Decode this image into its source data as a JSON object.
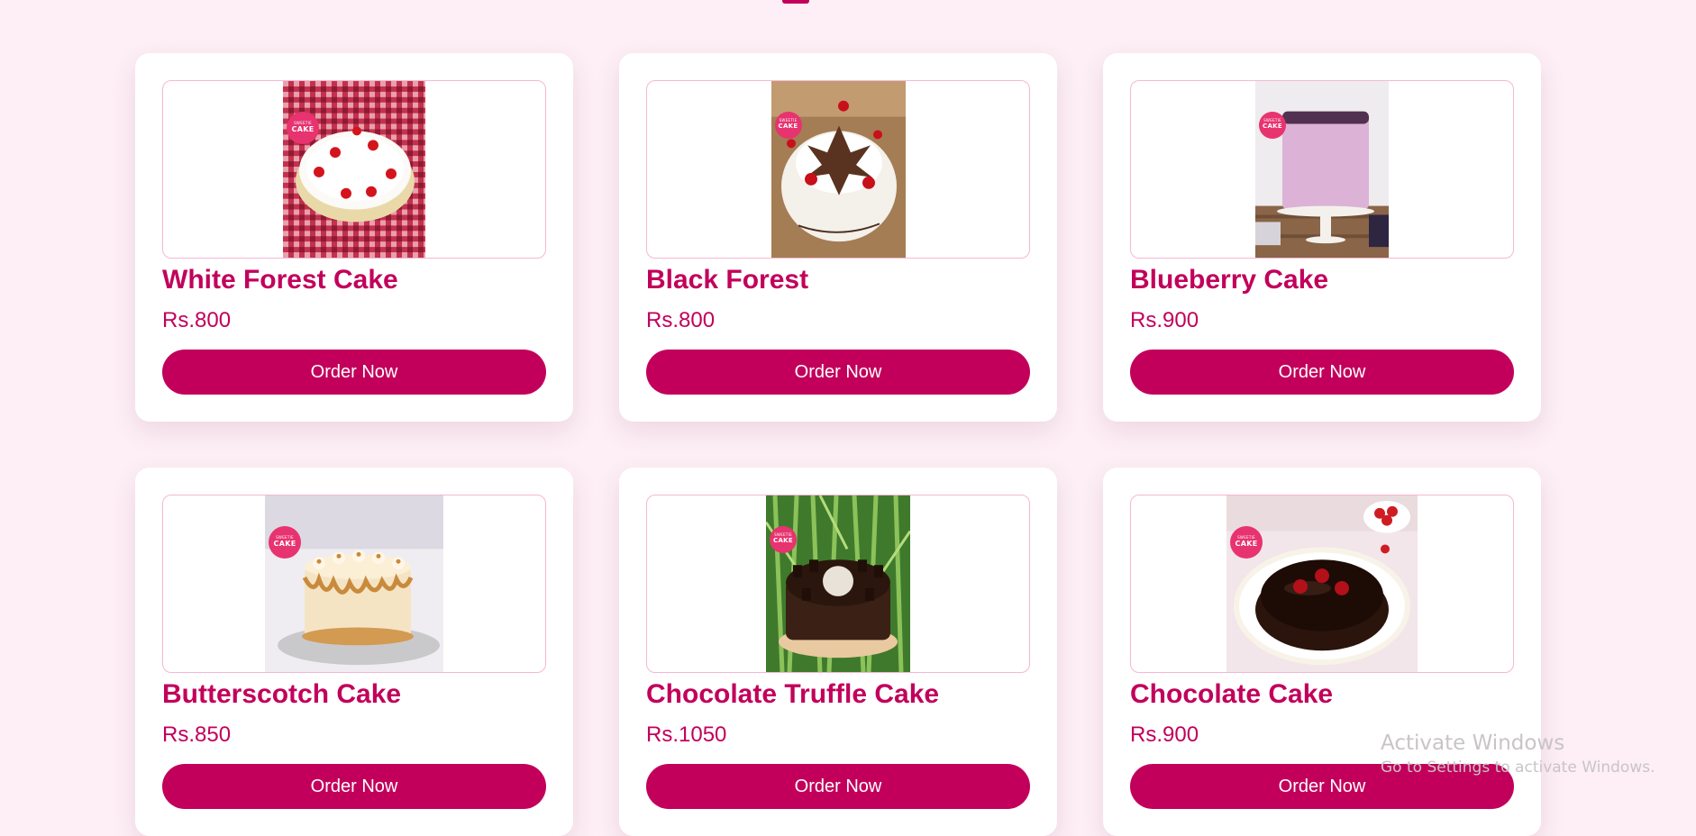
{
  "theme": {
    "background": "#fdeff5",
    "accent": "#c2005b",
    "card": "#ffffff",
    "frame_border": "#f6b7d2",
    "badge": "#e7336f"
  },
  "products": [
    {
      "name": "White Forest Cake",
      "price": "Rs.800",
      "button": "Order Now",
      "image": "white-forest-cake-photo"
    },
    {
      "name": "Black Forest",
      "price": "Rs.800",
      "button": "Order Now",
      "image": "black-forest-cake-photo"
    },
    {
      "name": "Blueberry Cake",
      "price": "Rs.900",
      "button": "Order Now",
      "image": "blueberry-cake-photo"
    },
    {
      "name": "Butterscotch Cake",
      "price": "Rs.850",
      "button": "Order Now",
      "image": "butterscotch-cake-photo"
    },
    {
      "name": "Chocolate Truffle Cake",
      "price": "Rs.1050",
      "button": "Order Now",
      "image": "chocolate-truffle-cake-photo"
    },
    {
      "name": "Chocolate Cake",
      "price": "Rs.900",
      "button": "Order Now",
      "image": "chocolate-cake-photo"
    }
  ],
  "logo_badge": {
    "text": "CAKE",
    "small": "SWEETIE"
  },
  "watermark": {
    "title": "Activate Windows",
    "subtitle": "Go to Settings to activate Windows."
  }
}
